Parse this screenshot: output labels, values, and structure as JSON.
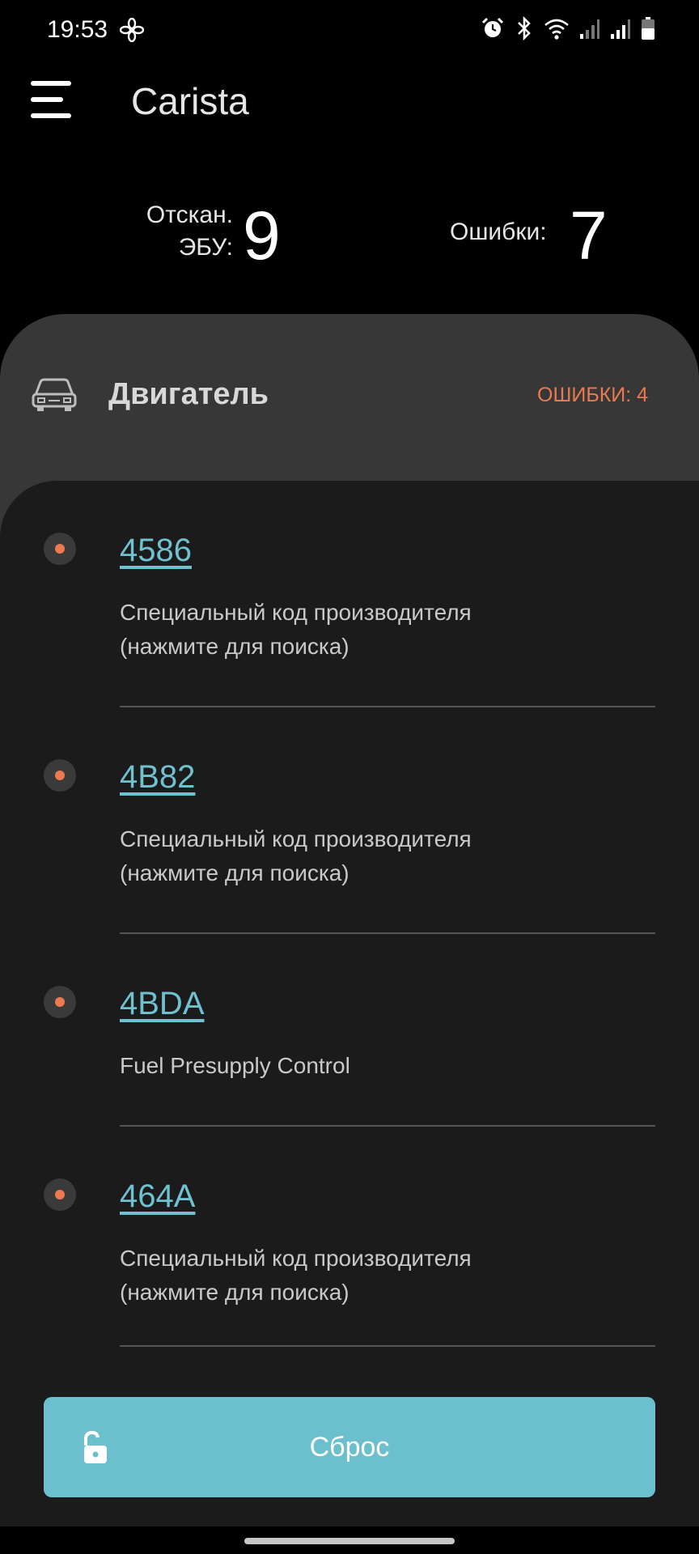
{
  "status_bar": {
    "time": "19:53",
    "icons": [
      "fan-icon",
      "alarm-icon",
      "bluetooth-icon",
      "wifi-icon",
      "signal-icon",
      "signal-icon",
      "battery-icon"
    ]
  },
  "app_bar": {
    "title": "Carista",
    "menu_icon": "menu-icon"
  },
  "summary": {
    "scanned_label_line1": "Отскан.",
    "scanned_label_line2": "ЭБУ:",
    "scanned_value": "9",
    "errors_label": "Ошибки:",
    "errors_value": "7"
  },
  "category": {
    "icon": "car-icon",
    "name": "Двигатель",
    "errors_badge": "ОШИБКИ: 4"
  },
  "errors": [
    {
      "code": "4586",
      "desc_line1": "Специальный код производителя",
      "desc_line2": "(нажмите для поиска)"
    },
    {
      "code": "4B82",
      "desc_line1": "Специальный код производителя",
      "desc_line2": "(нажмите для поиска)"
    },
    {
      "code": "4BDA",
      "desc_line1": "Fuel Presupply Control",
      "desc_line2": ""
    },
    {
      "code": "464A",
      "desc_line1": "Специальный код производителя",
      "desc_line2": "(нажмите для поиска)"
    }
  ],
  "reset_button": {
    "label": "Сброс",
    "icon": "unlock-icon"
  },
  "colors": {
    "accent_teal": "#6cbfcc",
    "link_teal": "#6fc1d0",
    "error_orange": "#ec7a50",
    "card_gray": "#373737",
    "panel_dark": "#1b1b1b"
  }
}
